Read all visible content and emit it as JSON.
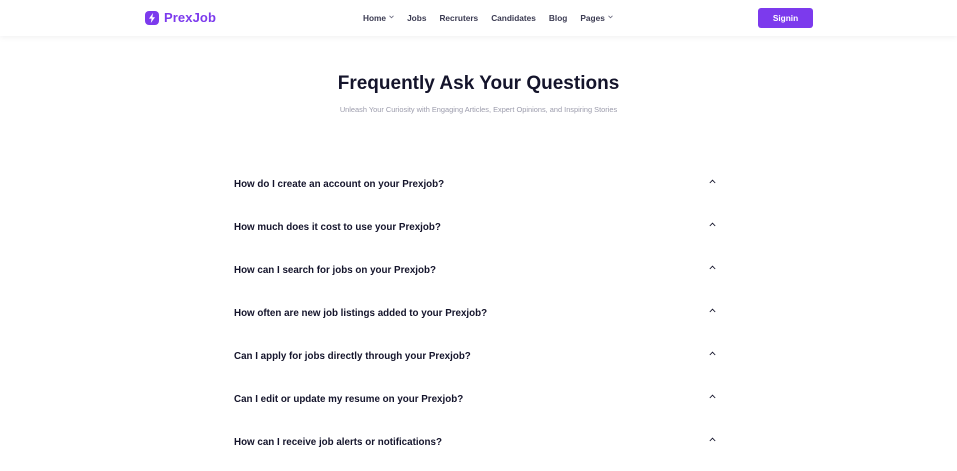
{
  "header": {
    "logo_text": "PrexJob",
    "nav": [
      {
        "label": "Home",
        "has_dropdown": true
      },
      {
        "label": "Jobs",
        "has_dropdown": false
      },
      {
        "label": "Recruters",
        "has_dropdown": false
      },
      {
        "label": "Candidates",
        "has_dropdown": false
      },
      {
        "label": "Blog",
        "has_dropdown": false
      },
      {
        "label": "Pages",
        "has_dropdown": true
      }
    ],
    "signin_label": "Signin"
  },
  "faq": {
    "title": "Frequently Ask Your Questions",
    "subtitle": "Unleash Your Curiosity with Engaging Articles, Expert Opinions, and Inspiring Stories",
    "items": [
      {
        "question": "How do I create an account on your Prexjob?"
      },
      {
        "question": "How much does it cost to use your Prexjob?"
      },
      {
        "question": "How can I search for jobs on your Prexjob?"
      },
      {
        "question": "How often are new job listings added to your Prexjob?"
      },
      {
        "question": "Can I apply for jobs directly through your Prexjob?"
      },
      {
        "question": "Can I edit or update my resume on your Prexjob?"
      },
      {
        "question": "How can I receive job alerts or notifications?"
      }
    ]
  },
  "colors": {
    "brand": "#7c3aed",
    "text": "#14142b",
    "muted": "#9c9cac"
  },
  "icons": {
    "logo": "lightning-bolt-icon",
    "nav_dropdown": "chevron-down-icon",
    "faq_toggle": "chevron-up-icon"
  }
}
